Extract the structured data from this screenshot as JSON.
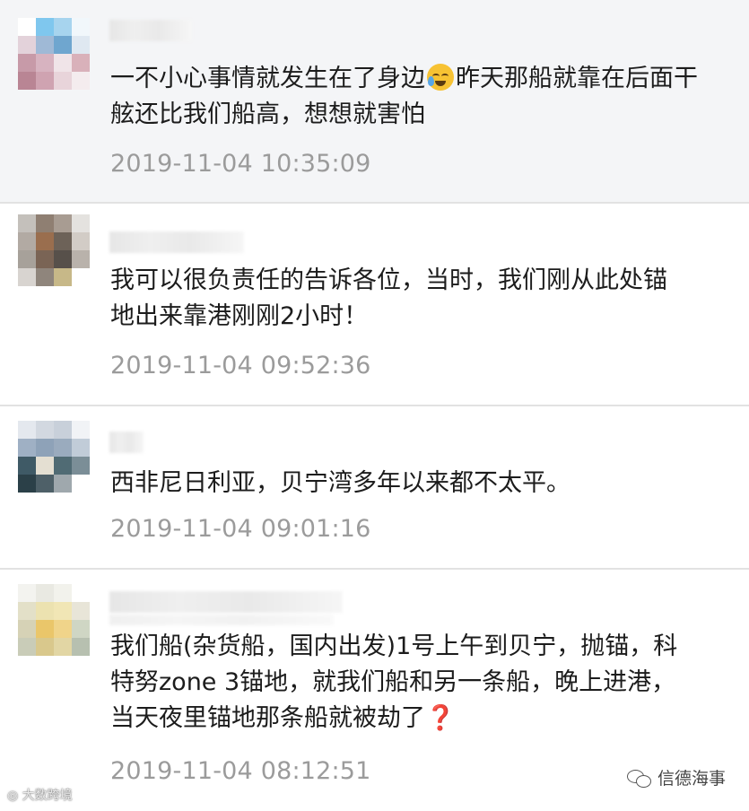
{
  "comments": [
    {
      "text_before_emoji": "一不小心事情就发生在了身边",
      "emoji": "face-with-tears-of-joy",
      "text_after_emoji": "昨天那船就靠在后面干舷还比我们船高，想想就害怕",
      "time": "2019-11-04 10:35:09",
      "highlighted": true
    },
    {
      "text": "我可以很负责任的告诉各位，当时，我们刚从此处锚地出来靠港刚刚2小时！",
      "time": "2019-11-04 09:52:36"
    },
    {
      "text": "西非尼日利亚，贝宁湾多年以来都不太平。",
      "time": "2019-11-04 09:01:16"
    },
    {
      "text_main": "我们船(杂货船，国内出发)1号上午到贝宁，抛锚，科特努zone 3锚地，就我们船和另一条船，晚上进港，当天夜里锚地那条船就被劫了",
      "end_mark": "❓",
      "time": "2019-11-04 08:12:51"
    }
  ],
  "watermarks": {
    "left": "大数跨境",
    "right": "信德海事"
  },
  "colors": {
    "text": "#1c1c1c",
    "timestamp": "#9b9b9b",
    "divider": "#e2e2e2",
    "highlight_bg": "#f4f5f7",
    "question_mark": "#d8262f"
  }
}
